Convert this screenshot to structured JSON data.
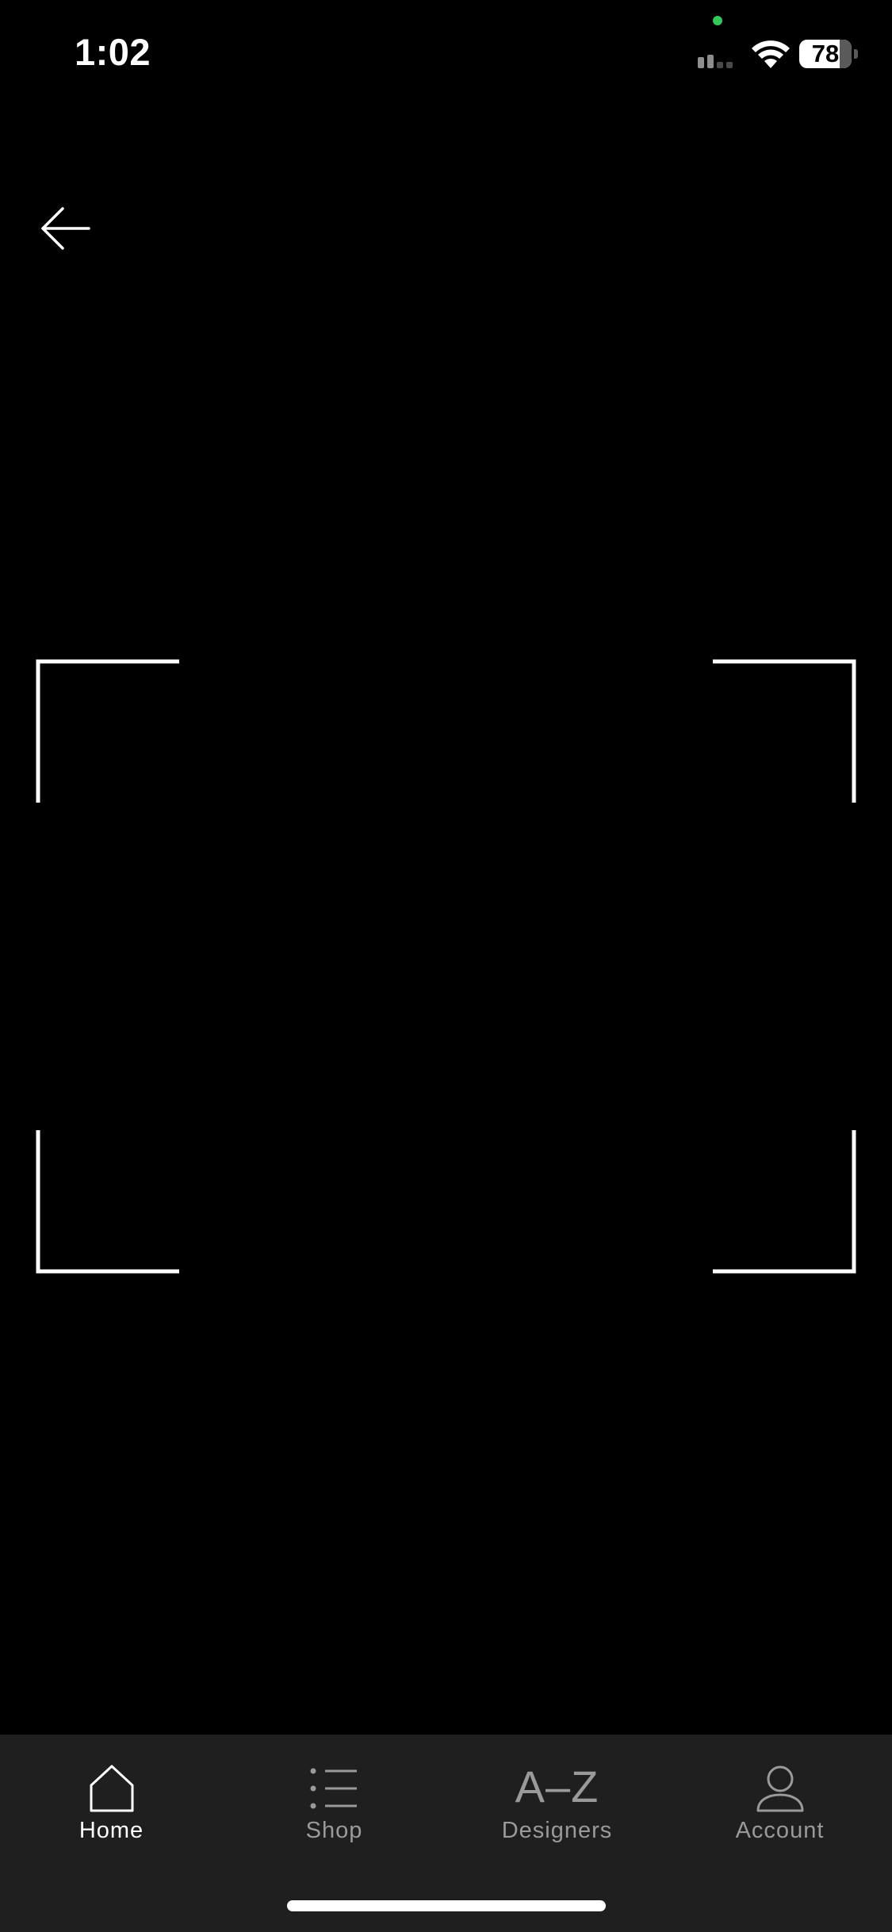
{
  "status_bar": {
    "time": "1:02",
    "battery_level": "78",
    "battery_fraction": 0.78,
    "privacy_indicator_color": "#34c759",
    "signal_icon": "cellular-signal-icon",
    "wifi_icon": "wifi-icon"
  },
  "header": {
    "back_icon": "arrow-left-icon"
  },
  "scanner": {
    "viewfinder_icon": "scan-corner-brackets"
  },
  "tab_bar": {
    "active_color": "#ffffff",
    "inactive_color": "#9a9a9a",
    "background_color": "#1f1f1f",
    "tabs": [
      {
        "label": "Home",
        "icon": "home-icon",
        "active": true
      },
      {
        "label": "Shop",
        "icon": "list-icon",
        "active": false
      },
      {
        "label": "Designers",
        "icon_text": "A–Z",
        "active": false
      },
      {
        "label": "Account",
        "icon": "person-icon",
        "active": false
      }
    ]
  }
}
